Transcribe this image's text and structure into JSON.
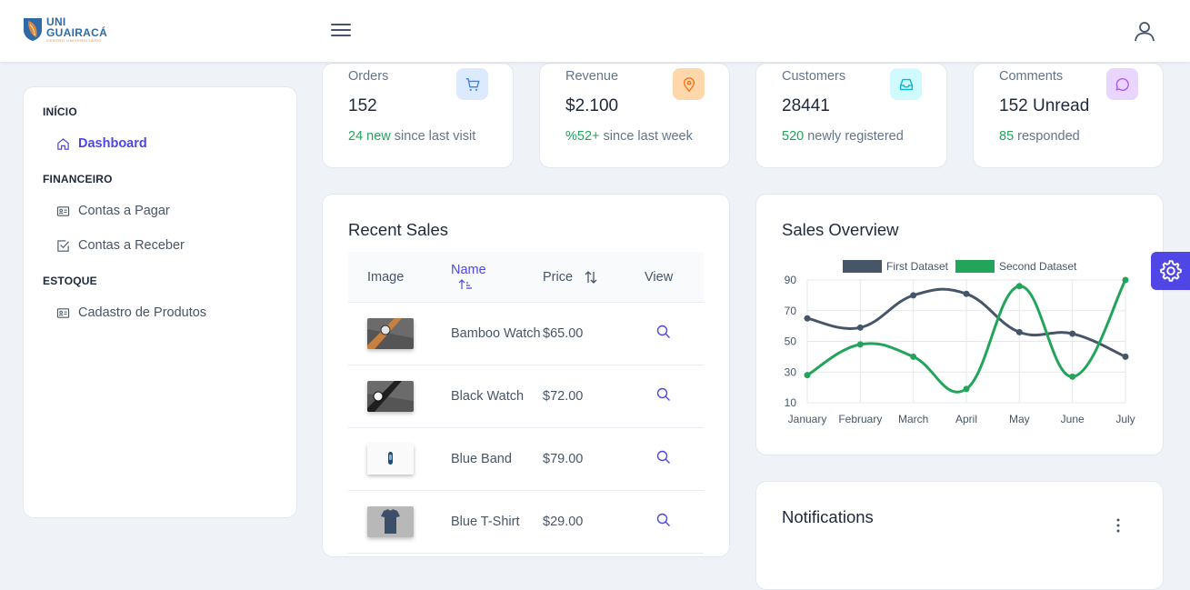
{
  "brand": {
    "line1": "UNI",
    "line2": "GUAIRACÁ",
    "line3": "CENTRO UNIVERSITÁRIO"
  },
  "sidebar": {
    "sections": [
      {
        "title": "INÍCIO",
        "items": [
          {
            "label": "Dashboard",
            "icon": "home-icon",
            "active": true
          }
        ]
      },
      {
        "title": "FINANCEIRO",
        "items": [
          {
            "label": "Contas a Pagar",
            "icon": "id-card-icon"
          },
          {
            "label": "Contas a Receber",
            "icon": "check-square-icon"
          }
        ]
      },
      {
        "title": "ESTOQUE",
        "items": [
          {
            "label": "Cadastro de Produtos",
            "icon": "id-card-icon"
          }
        ]
      }
    ]
  },
  "stats": [
    {
      "label": "Orders",
      "value": "152",
      "highlight": "24 new",
      "rest": " since last visit",
      "icon": "cart-icon",
      "icon_bg": "#dbeafe",
      "icon_color": "#3b82f6"
    },
    {
      "label": "Revenue",
      "value": "$2.100",
      "highlight": "%52+",
      "rest": " since last week",
      "icon": "map-pin-icon",
      "icon_bg": "#fed7aa",
      "icon_color": "#f97316"
    },
    {
      "label": "Customers",
      "value": "28441",
      "highlight": "520",
      "rest": " newly registered",
      "icon": "inbox-icon",
      "icon_bg": "#cffafe",
      "icon_color": "#06b6d4"
    },
    {
      "label": "Comments",
      "value": "152 Unread",
      "highlight": "85",
      "rest": " responded",
      "icon": "comment-icon",
      "icon_bg": "#e9d5ff",
      "icon_color": "#a855f7"
    }
  ],
  "recent_sales": {
    "title": "Recent Sales",
    "columns": {
      "image": "Image",
      "name": "Name",
      "price": "Price",
      "view": "View"
    },
    "rows": [
      {
        "name": "Bamboo Watch",
        "price": "$65.00"
      },
      {
        "name": "Black Watch",
        "price": "$72.00"
      },
      {
        "name": "Blue Band",
        "price": "$79.00"
      },
      {
        "name": "Blue T-Shirt",
        "price": "$29.00"
      }
    ]
  },
  "sales_overview": {
    "title": "Sales Overview"
  },
  "notifications": {
    "title": "Notifications"
  },
  "chart_data": {
    "type": "line",
    "title": "",
    "categories": [
      "January",
      "February",
      "March",
      "April",
      "May",
      "June",
      "July"
    ],
    "series": [
      {
        "name": "First Dataset",
        "values": [
          65,
          59,
          80,
          81,
          56,
          55,
          40
        ],
        "color": "#475569"
      },
      {
        "name": "Second Dataset",
        "values": [
          28,
          48,
          40,
          19,
          86,
          27,
          90
        ],
        "color": "#22a55b"
      }
    ],
    "yticks": [
      10,
      30,
      50,
      70,
      90
    ],
    "ylim": [
      10,
      90
    ],
    "grid": true,
    "legend": "top"
  }
}
